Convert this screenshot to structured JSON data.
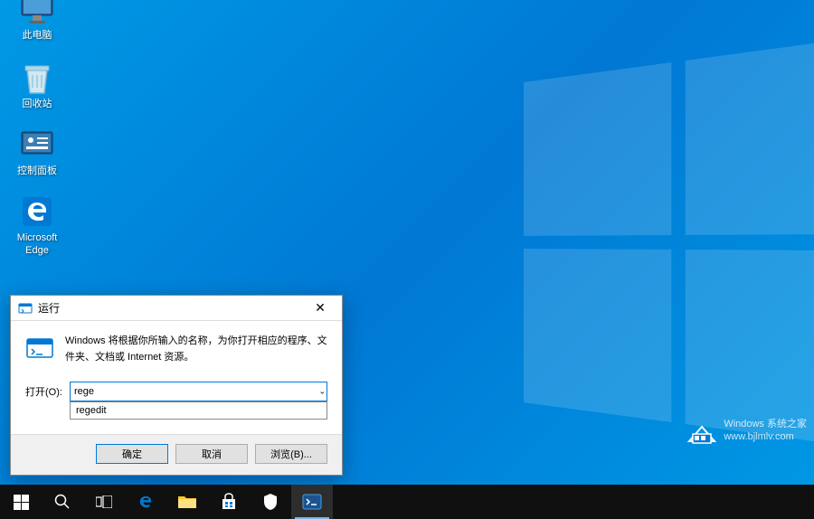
{
  "desktop": {
    "icons": {
      "this_pc": "此电脑",
      "recycle_bin": "回收站",
      "control_panel": "控制面板",
      "edge": "Microsoft\nEdge"
    }
  },
  "run_dialog": {
    "title": "运行",
    "description": "Windows 将根据你所输入的名称，为你打开相应的程序、文件夹、文档或 Internet 资源。",
    "input_label": "打开(O):",
    "input_value": "rege",
    "autocomplete": [
      "regedit"
    ],
    "buttons": {
      "ok": "确定",
      "cancel": "取消",
      "browse": "浏览(B)..."
    },
    "close": "✕"
  },
  "watermark": {
    "line1": "Windows 系统之家",
    "line2": "www.bjlmlv.com"
  }
}
